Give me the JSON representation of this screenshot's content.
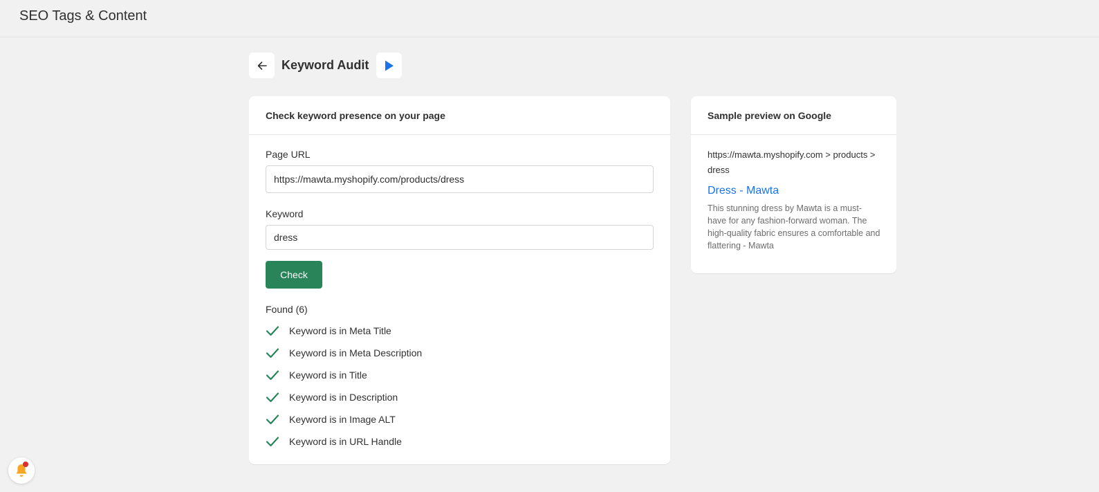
{
  "app": {
    "title": "SEO Tags & Content"
  },
  "page": {
    "title": "Keyword Audit",
    "back_icon": "arrow-left-icon",
    "play_icon": "play-icon"
  },
  "audit_card": {
    "header": "Check keyword presence on your page",
    "url_label": "Page URL",
    "url_value": "https://mawta.myshopify.com/products/dress",
    "keyword_label": "Keyword",
    "keyword_value": "dress",
    "check_label": "Check",
    "found_title": "Found (6)",
    "results": [
      "Keyword is in Meta Title",
      "Keyword is in Meta Description",
      "Keyword is in Title",
      "Keyword is in Description",
      "Keyword is in Image ALT",
      "Keyword is in URL Handle"
    ]
  },
  "preview_card": {
    "header": "Sample preview on Google",
    "url": "https://mawta.myshopify.com > products > dress",
    "title": "Dress - Mawta",
    "description": "This stunning dress by Mawta is a must-have for any fashion-forward woman. The high-quality fabric ensures a comfortable and flattering - Mawta"
  },
  "colors": {
    "primary_button": "#29845a",
    "check_icon": "#29845a",
    "link_blue": "#1a73e8",
    "play_blue": "#1a73e8",
    "bell": "#f5a623",
    "notification_dot": "#e02c2c"
  }
}
